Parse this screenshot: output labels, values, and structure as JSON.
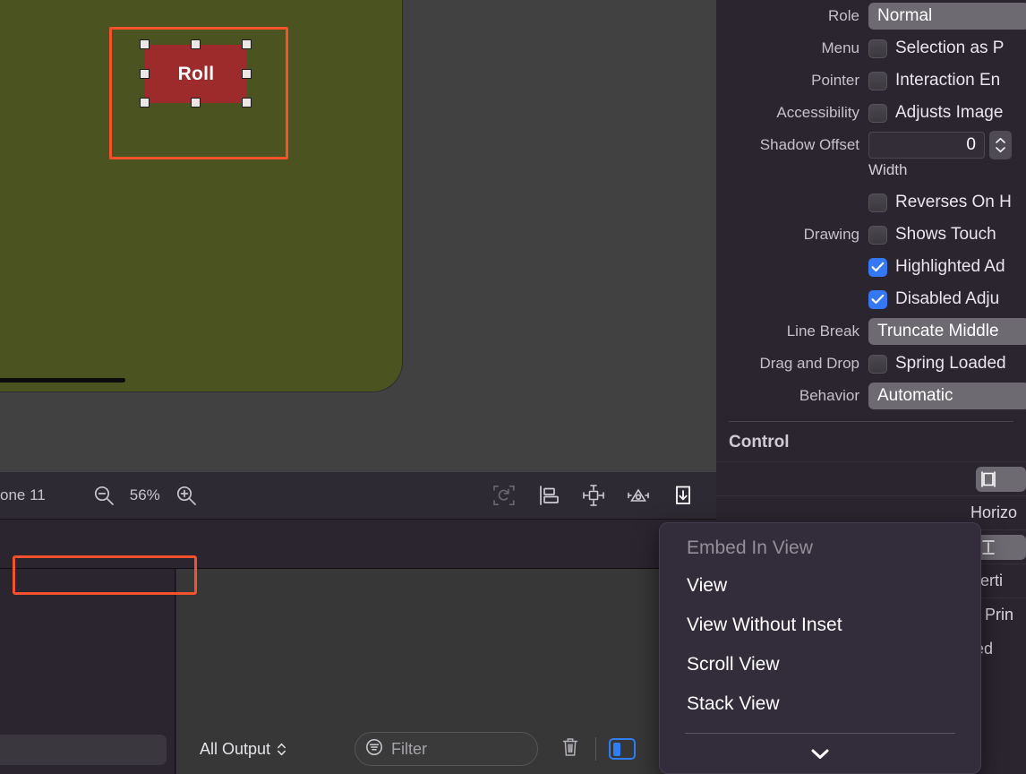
{
  "canvas": {
    "device_name": "one 11",
    "zoom_level": "56%",
    "button_title": "Roll",
    "zoom_out_icon": "zoom-out-icon",
    "zoom_in_icon": "zoom-in-icon",
    "toolbar_icons": [
      {
        "name": "update-frames-icon",
        "label": "Update Frames",
        "state": "disabled"
      },
      {
        "name": "align-icon",
        "label": "Align",
        "state": "normal"
      },
      {
        "name": "add-new-constraints-icon",
        "label": "Add New Constraints",
        "state": "normal"
      },
      {
        "name": "resolve-auto-layout-issues-icon",
        "label": "Resolve Auto Layout Issues",
        "state": "normal"
      },
      {
        "name": "embed-in-icon",
        "label": "Embed In",
        "state": "active"
      }
    ]
  },
  "console": {
    "scope_label": "All Output",
    "filter_placeholder": "Filter",
    "trash_icon": "trash-icon",
    "filter_icon": "filter-icon",
    "panel_toggle_icon": "console-panel-toggle-icon"
  },
  "inspector": {
    "rows": [
      {
        "label": "Role",
        "type": "popup",
        "value": "Normal"
      },
      {
        "label": "Menu",
        "type": "checkbox",
        "checked": false,
        "text": "Selection as P"
      },
      {
        "label": "Pointer",
        "type": "checkbox",
        "checked": false,
        "text": "Interaction En"
      },
      {
        "label": "Accessibility",
        "type": "checkbox",
        "checked": false,
        "text": "Adjusts Image"
      },
      {
        "label": "Shadow Offset",
        "type": "number",
        "value": "0",
        "caption": "Width"
      },
      {
        "label": "",
        "type": "checkbox",
        "checked": false,
        "text": "Reverses On H"
      },
      {
        "label": "Drawing",
        "type": "checkbox",
        "checked": false,
        "text": "Shows Touch "
      },
      {
        "label": "",
        "type": "checkbox",
        "checked": true,
        "text": "Highlighted Ad"
      },
      {
        "label": "",
        "type": "checkbox",
        "checked": true,
        "text": "Disabled Adju"
      },
      {
        "label": "Line Break",
        "type": "popup",
        "value": "Truncate Middle"
      },
      {
        "label": "Drag and Drop",
        "type": "checkbox",
        "checked": false,
        "text": "Spring Loaded"
      },
      {
        "label": "Behavior",
        "type": "popup",
        "value": "Automatic"
      }
    ],
    "section_title": "Control",
    "control_rows": [
      {
        "icon": "horizontal-hugging-icon",
        "text": "Horizo"
      },
      {
        "icon": "vertical-hugging-icon",
        "text": "Verti"
      },
      {
        "icon": "",
        "text": "Prin"
      }
    ],
    "bottom_text": "ted"
  },
  "popup_menu": {
    "header": "Embed In View",
    "items": [
      {
        "label": "View",
        "highlighted": true
      },
      {
        "label": "View Without Inset",
        "highlighted": false
      },
      {
        "label": "Scroll View",
        "highlighted": false
      },
      {
        "label": "Stack View",
        "highlighted": false
      }
    ],
    "expand_icon": "chevron-down-icon"
  },
  "colors": {
    "accent_red": "#f4512c",
    "checkbox_blue": "#3478f6",
    "device_green": "#4b5320",
    "button_red": "#9d2b2b",
    "panel_bg": "#2b252f",
    "canvas_bg": "#414141"
  }
}
